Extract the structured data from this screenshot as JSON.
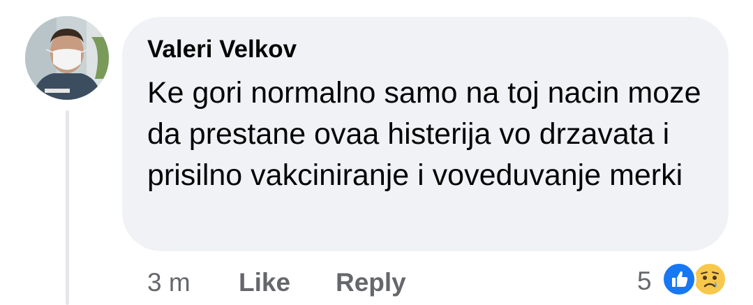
{
  "comment": {
    "author": "Valeri Velkov",
    "text": "Ke gori normalno samo na toj nacin moze da prestane ovaa histerija vo drzavata i prisilno vakciniranje i voveduvanje merki",
    "time": "3 m",
    "like_label": "Like",
    "reply_label": "Reply",
    "reaction_count": "5",
    "reactions": [
      "like-icon",
      "sad-icon"
    ]
  },
  "colors": {
    "bubble_bg": "#f0f2f5",
    "text": "#050505",
    "meta_text": "#65676b",
    "like_blue": "#1877f2",
    "sad_yellow": "#f7c84b"
  }
}
